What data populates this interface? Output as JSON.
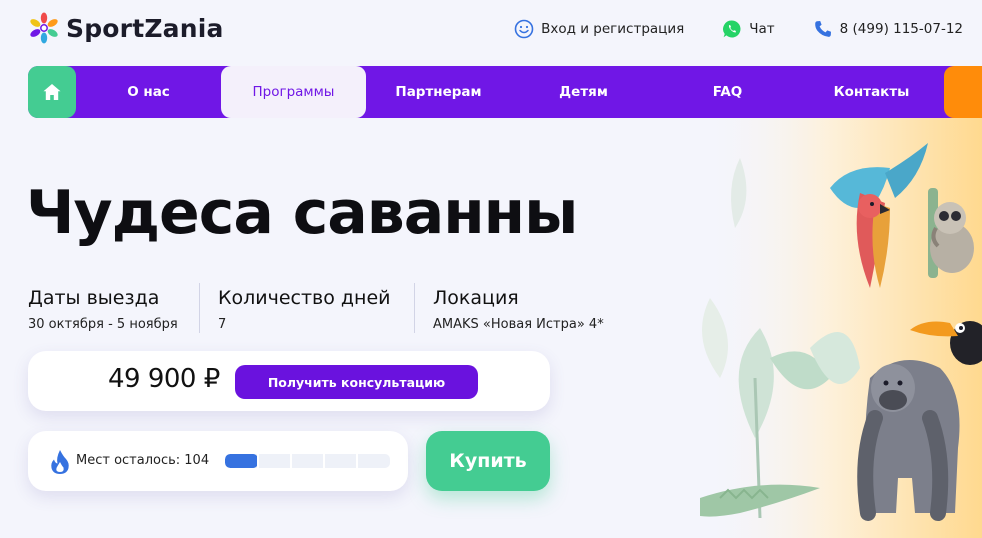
{
  "header": {
    "brand": "SportZania",
    "login_label": "Вход и регистрация",
    "chat_label": "Чат",
    "phone": "8 (499) 115-07-12"
  },
  "nav": {
    "items": [
      {
        "label": "О нас"
      },
      {
        "label": "Программы",
        "active": true
      },
      {
        "label": "Партнерам"
      },
      {
        "label": "Детям"
      },
      {
        "label": "FAQ"
      },
      {
        "label": "Контакты"
      }
    ]
  },
  "hero": {
    "title": "Чудеса саванны",
    "info": [
      {
        "label": "Даты выезда",
        "value": "30 октября - 5 ноября"
      },
      {
        "label": "Количество дней",
        "value": "7"
      },
      {
        "label": "Локация",
        "value": "AMAKS «Новая Истра» 4*"
      }
    ],
    "price": "49 900 ₽",
    "consult_label": "Получить консультацию",
    "seats_label": "Мест осталось: 104",
    "seats_progress": 0.2,
    "buy_label": "Купить"
  },
  "colors": {
    "brand_purple": "#7017e6",
    "accent_green": "#44cc92",
    "accent_orange": "#ff8c0a",
    "progress_blue": "#3672e0"
  },
  "icons": [
    "logo-snowflake-icon",
    "smile-icon",
    "whatsapp-icon",
    "phone-icon",
    "home-icon",
    "fire-icon"
  ]
}
